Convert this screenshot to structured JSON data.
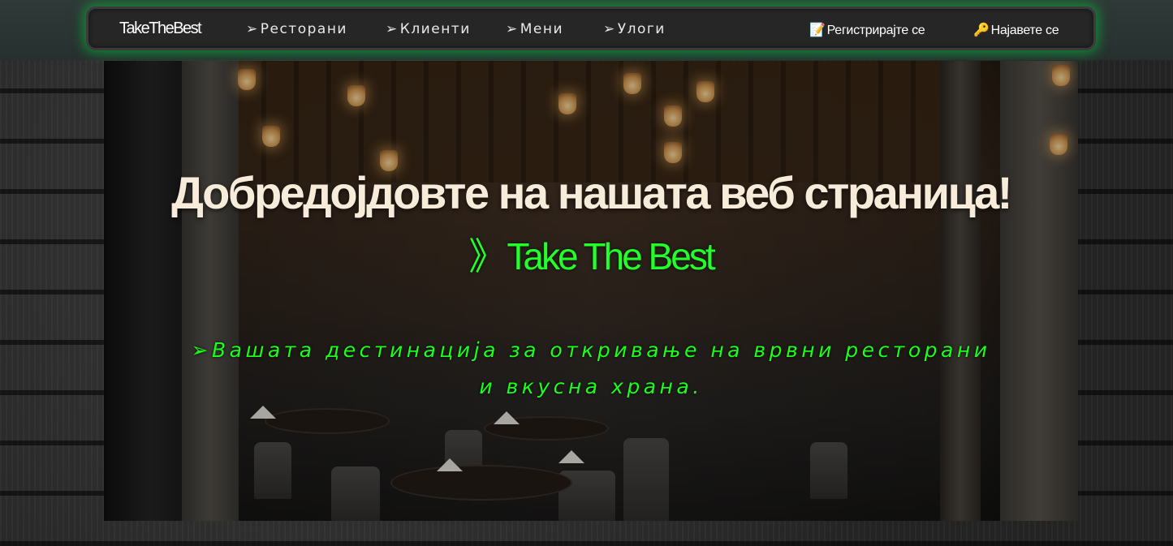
{
  "navbar": {
    "brand": "TakeTheBest",
    "links": [
      {
        "label": "Ресторани",
        "arrow": "➢"
      },
      {
        "label": "Клиенти",
        "arrow": "➢"
      },
      {
        "label": "Мени",
        "arrow": "➢"
      },
      {
        "label": "Улоги",
        "arrow": "➢"
      }
    ],
    "register": {
      "label": "Регистрирајте се",
      "icon": "📝"
    },
    "login": {
      "label": "Најавете се",
      "icon": "🔑"
    }
  },
  "hero": {
    "title": "Добредојдовте на нашата веб страница!",
    "brand_prefix": "》",
    "brand": "Take The Best",
    "tagline_arrow": "➢",
    "tagline": "Вашата дестинација за откривање на врвни ресторани и вкусна храна."
  },
  "colors": {
    "accent": "#23ff2a",
    "title": "#f7ebd9",
    "nav_bg": "#262626",
    "glow": "#00c83c"
  }
}
